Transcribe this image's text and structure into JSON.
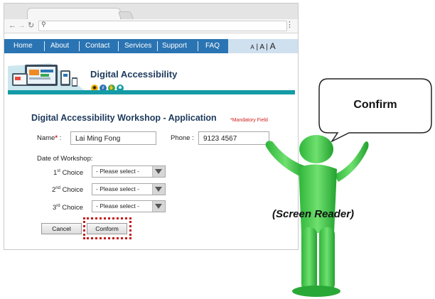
{
  "browser": {
    "back_icon": "back-arrow-icon",
    "forward_icon": "forward-arrow-icon",
    "reload_icon": "reload-icon",
    "search_icon": "search-icon",
    "menu_icon": "kebab-menu-icon"
  },
  "nav": {
    "items": [
      "Home",
      "About",
      "Contact",
      "Services",
      "Support",
      "FAQ"
    ],
    "font_sizes": [
      "A",
      "A",
      "A"
    ]
  },
  "site": {
    "title": "Digital Accessibility",
    "badge_icons": [
      "eye-icon",
      "ear-icon",
      "hand-icon",
      "brain-icon"
    ]
  },
  "form": {
    "title": "Digital Accessibility Workshop - Application",
    "mandatory_note": "*Mandatory Field",
    "name_label": "Name",
    "name_required": "*",
    "name_colon": ":",
    "name_value": "Lai Ming Fong",
    "phone_label": "Phone :",
    "phone_value": "9123 4567",
    "date_label": "Date of Workshop:",
    "choices": [
      {
        "num": "1",
        "sup": "st",
        "word": " Choice",
        "selected": "- Please select -"
      },
      {
        "num": "2",
        "sup": "nd",
        "word": " Choice",
        "selected": "- Please select -"
      },
      {
        "num": "3",
        "sup": "rd",
        "word": " Choice",
        "selected": "- Please select -"
      }
    ],
    "cancel_label": "Cancel",
    "confirm_label": "Conform"
  },
  "screen_reader": {
    "speech": "Confirm",
    "caption": "(Screen Reader)"
  },
  "colors": {
    "nav_blue": "#2a74b3",
    "focus_red": "#c71a1a",
    "figure_green": "#3fcf4a",
    "title_navy": "#1d3a5c"
  }
}
